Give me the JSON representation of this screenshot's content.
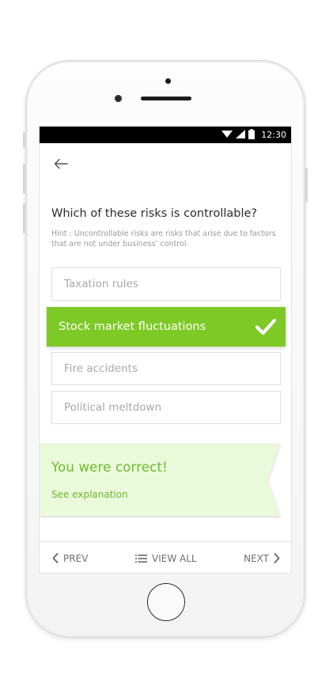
{
  "status_bar": {
    "time": "12:30",
    "icons": [
      "wifi-icon",
      "signal-icon",
      "battery-icon"
    ]
  },
  "header": {
    "back_icon": "arrow-left-icon"
  },
  "quiz": {
    "question": "Which of these risks is controllable?",
    "hint": "Hint : Uncontrollable risks are risks that arise due to factors that are not under business’ control.",
    "options": [
      {
        "label": "Taxation rules",
        "state": "default"
      },
      {
        "label": "Stock market fluctuations",
        "state": "selected-correct"
      },
      {
        "label": "Fire accidents",
        "state": "default"
      },
      {
        "label": "Political meltdown",
        "state": "default"
      }
    ]
  },
  "feedback": {
    "title": "You were correct!",
    "link": "See explanation"
  },
  "bottom_nav": {
    "prev_label": "PREV",
    "view_all_label": "VIEW ALL",
    "next_label": "NEXT"
  },
  "colors": {
    "accent_green": "#7dc926",
    "feedback_bg": "#e9f9da",
    "feedback_text": "#6fb92c",
    "status_bar": "#000000"
  }
}
